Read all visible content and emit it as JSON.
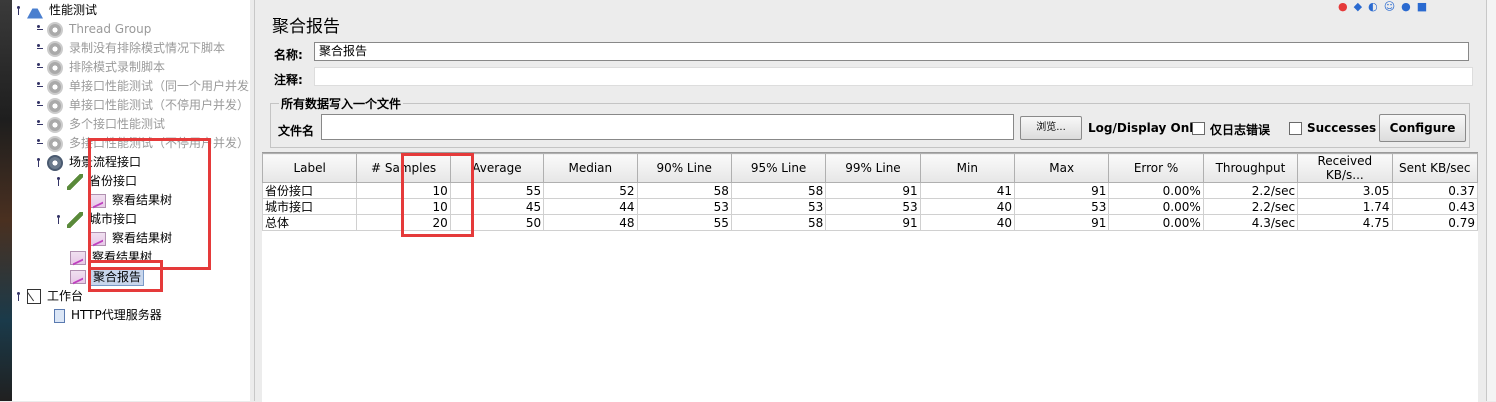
{
  "tree": {
    "root": "性能测试",
    "items": [
      {
        "label": "Thread Group",
        "disabled": true
      },
      {
        "label": "录制没有排除模式情况下脚本",
        "disabled": true
      },
      {
        "label": "排除模式录制脚本",
        "disabled": true
      },
      {
        "label": "单接口性能测试（同一个用户并发",
        "disabled": true
      },
      {
        "label": "单接口性能测试（不停用户并发）",
        "disabled": true
      },
      {
        "label": "多个接口性能测试",
        "disabled": true
      },
      {
        "label": "多接口性能测试（不停用户并发）",
        "disabled": true
      }
    ],
    "scenario": "场景流程接口",
    "province": "省份接口",
    "view1": "察看结果树",
    "city": "城市接口",
    "view2": "察看结果树",
    "view3": "察看结果树",
    "aggregate": "聚合报告",
    "workbench": "工作台",
    "proxy": "HTTP代理服务器"
  },
  "panel": {
    "title": "聚合报告",
    "name_label": "名称:",
    "name_value": "聚合报告",
    "comment_label": "注释:",
    "comment_value": "",
    "group_title": "所有数据写入一个文件",
    "file_label": "文件名",
    "file_value": "",
    "browse": "浏览...",
    "log_display": "Log/Display Only:",
    "errors_only": "仅日志错误",
    "successes": "Successes",
    "configure": "Configure"
  },
  "table": {
    "columns": [
      "Label",
      "# Samples",
      "Average",
      "Median",
      "90% Line",
      "95% Line",
      "99% Line",
      "Min",
      "Max",
      "Error %",
      "Throughput",
      "Received KB/s...",
      "Sent KB/sec"
    ],
    "rows": [
      [
        "省份接口",
        "10",
        "55",
        "52",
        "58",
        "58",
        "91",
        "41",
        "91",
        "0.00%",
        "2.2/sec",
        "3.05",
        "0.37"
      ],
      [
        "城市接口",
        "10",
        "45",
        "44",
        "53",
        "53",
        "53",
        "40",
        "53",
        "0.00%",
        "2.2/sec",
        "1.74",
        "0.43"
      ],
      [
        "总体",
        "20",
        "50",
        "48",
        "55",
        "58",
        "91",
        "40",
        "91",
        "0.00%",
        "4.3/sec",
        "4.75",
        "0.79"
      ]
    ]
  },
  "colors": {
    "highlight": "#e53a3a",
    "selected": "#c8d6ec"
  },
  "icons": [
    "flask-icon",
    "gear-icon",
    "pen-icon",
    "chart-icon",
    "workbench-icon",
    "proxy-icon"
  ]
}
